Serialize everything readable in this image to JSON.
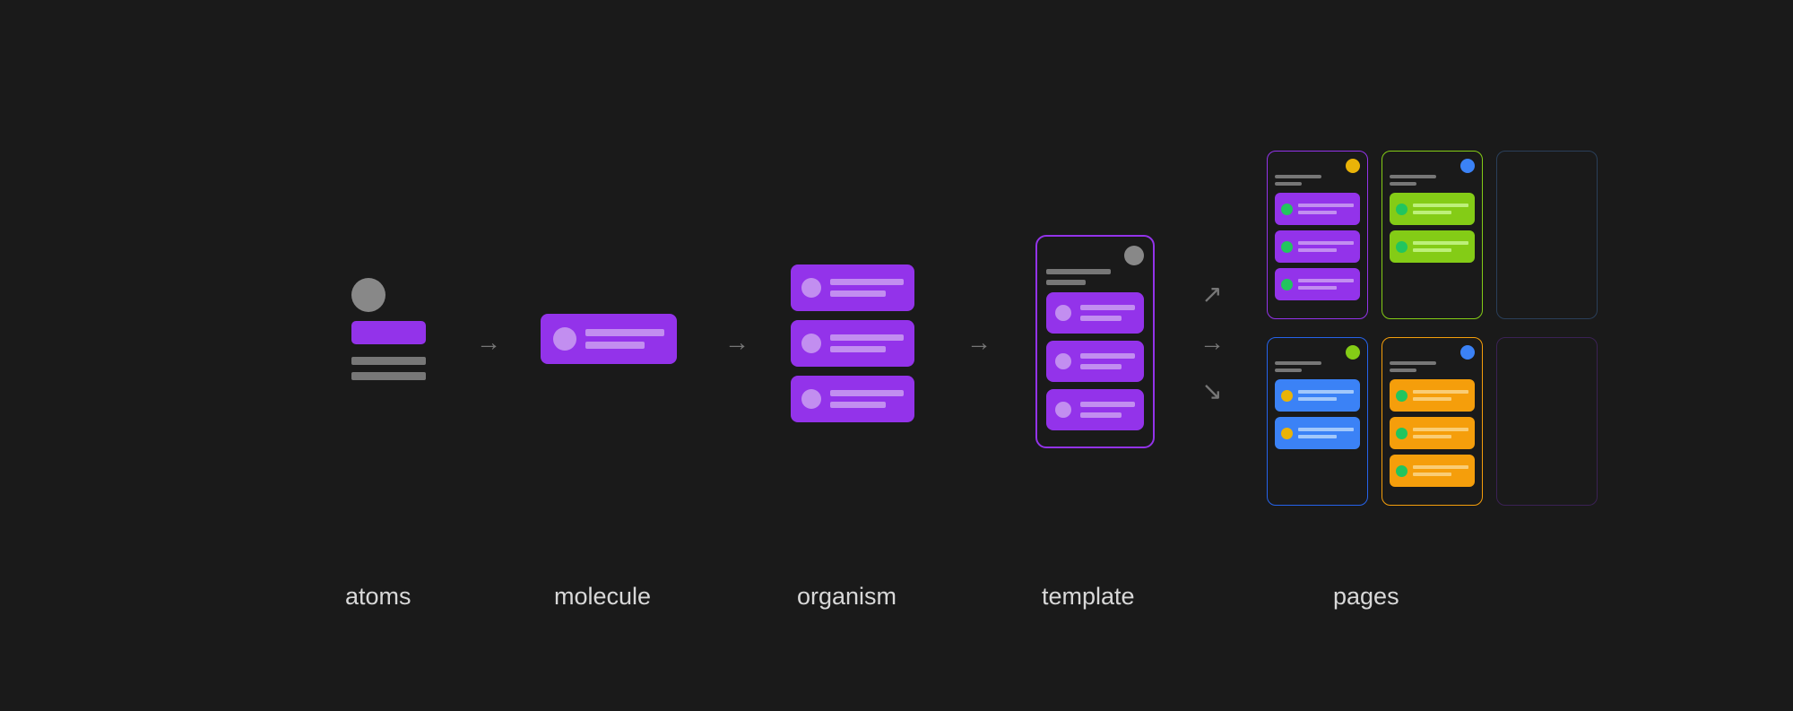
{
  "labels": {
    "atoms": "atoms",
    "molecule": "molecule",
    "organism": "organism",
    "template": "template",
    "pages": "pages"
  },
  "colors": {
    "bg": "#1a1a1a",
    "grey": "#888888",
    "purple": "#9333ea",
    "purple_light": "#c28ef0",
    "green": "#84cc16",
    "blue": "#3b82f6",
    "orange": "#f59e0b",
    "yellow": "#eab308",
    "arrow": "#767676",
    "text": "#d8d8d8"
  },
  "stages": [
    {
      "name": "atoms",
      "description": "circle shape, purple bar, two grey lines"
    },
    {
      "name": "molecule",
      "description": "single purple card with avatar and two text lines"
    },
    {
      "name": "organism",
      "description": "stack of 3 purple cards"
    },
    {
      "name": "template",
      "description": "phone frame (purple border) containing header + 3 purple cards"
    },
    {
      "name": "pages",
      "description": "2×3 grid of phone frames in purple/green/blue/orange + 2 faded"
    }
  ],
  "pages_grid": [
    {
      "border": "purple",
      "profile": "yellow",
      "card": "purple",
      "avatar": "green",
      "card_count": 3
    },
    {
      "border": "green",
      "profile": "blue",
      "card": "green",
      "avatar": "green",
      "card_count": 2
    },
    {
      "border": "ghost-blue",
      "card_count": 0
    },
    {
      "border": "blue",
      "profile": "green",
      "card": "blue",
      "avatar": "yellow",
      "card_count": 2
    },
    {
      "border": "orange",
      "profile": "blue",
      "card": "orange",
      "avatar": "green",
      "card_count": 3
    },
    {
      "border": "ghost-purple",
      "card_count": 0
    }
  ],
  "arrows_between_stages": [
    "→",
    "→",
    "→",
    "→"
  ],
  "arrows_fanout": [
    "↗",
    "→",
    "↘"
  ]
}
